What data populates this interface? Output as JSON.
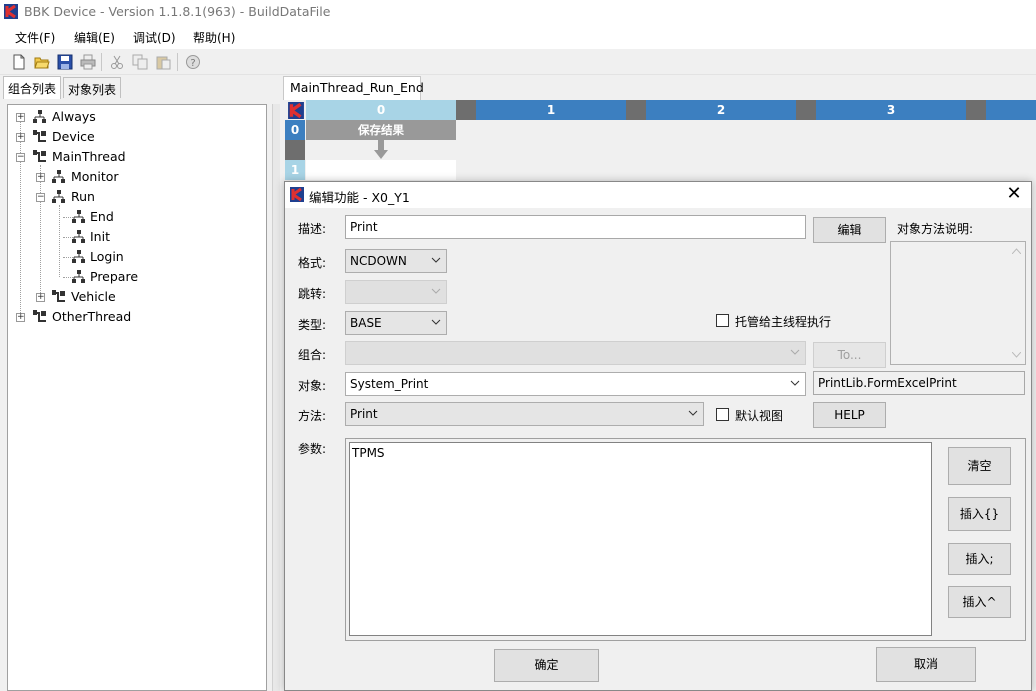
{
  "window": {
    "title": "BBK Device - Version 1.1.8.1(963) - BuildDataFile"
  },
  "menu": {
    "file": "文件(F)",
    "edit": "编辑(E)",
    "debug": "调试(D)",
    "help": "帮助(H)"
  },
  "left_tabs": {
    "group_list": "组合列表",
    "object_list": "对象列表"
  },
  "tree": {
    "always": "Always",
    "device": "Device",
    "mainthread": "MainThread",
    "monitor": "Monitor",
    "run": "Run",
    "end": "End",
    "init": "Init",
    "login": "Login",
    "prepare": "Prepare",
    "vehicle": "Vehicle",
    "otherthread": "OtherThread"
  },
  "document": {
    "tab": "MainThread_Run_End",
    "columns": [
      "0",
      "1",
      "2",
      "3"
    ],
    "rows": [
      "0",
      "1"
    ],
    "cell_0_0": "保存结果"
  },
  "dialog": {
    "title": "编辑功能 - X0_Y1",
    "desc_label": "描述:",
    "desc_value": "Print",
    "edit_button": "编辑",
    "method_desc_label": "对象方法说明:",
    "format_label": "格式:",
    "format_value": "NCDOWN",
    "jump_label": "跳转:",
    "type_label": "类型:",
    "type_value": "BASE",
    "delegate_label": "托管给主线程执行",
    "combo_label": "组合:",
    "to_button": "To...",
    "object_label": "对象:",
    "object_value": "System_Print",
    "object_lib": "PrintLib.FormExcelPrint",
    "method_label": "方法:",
    "method_value": "Print",
    "default_view_label": "默认视图",
    "help_button": "HELP",
    "params_label": "参数:",
    "params_value": "TPMS",
    "clear_button": "清空",
    "insert_brace_button": "插入{}",
    "insert_semicolon_button": "插入;",
    "insert_caret_button": "插入^",
    "ok_button": "确定",
    "cancel_button": "取消"
  },
  "colors": {
    "col_header_active": "#a8d4e6",
    "col_header": "#3c7fc0",
    "col_header_gap": "#6e6e6e",
    "row_header_active": "#3c7fc0",
    "row_header_inactive": "#a8d4e6"
  }
}
